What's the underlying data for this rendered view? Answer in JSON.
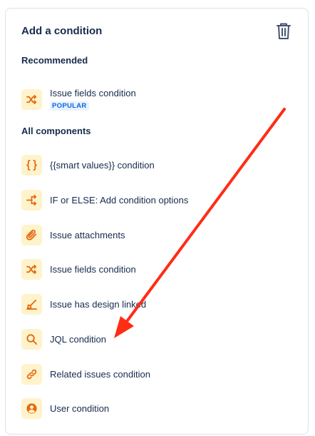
{
  "panel": {
    "title": "Add a condition",
    "delete_icon": "trash-icon"
  },
  "recommended": {
    "heading": "Recommended",
    "items": [
      {
        "label": "Issue fields condition",
        "badge": "POPULAR",
        "icon": "shuffle-icon"
      }
    ]
  },
  "all_components": {
    "heading": "All components",
    "items": [
      {
        "label": "{{smart values}} condition",
        "icon": "curly-braces-icon"
      },
      {
        "label": "IF or ELSE: Add condition options",
        "icon": "branch-icon"
      },
      {
        "label": "Issue attachments",
        "icon": "paperclip-icon"
      },
      {
        "label": "Issue fields condition",
        "icon": "shuffle-icon"
      },
      {
        "label": "Issue has design linked",
        "icon": "design-pen-icon"
      },
      {
        "label": "JQL condition",
        "icon": "search-icon"
      },
      {
        "label": "Related issues condition",
        "icon": "link-icon"
      },
      {
        "label": "User condition",
        "icon": "user-icon"
      }
    ]
  },
  "colors": {
    "icon_accent": "#e56910",
    "icon_bg": "#fff3cc",
    "annotation_arrow": "#ff2d14"
  }
}
